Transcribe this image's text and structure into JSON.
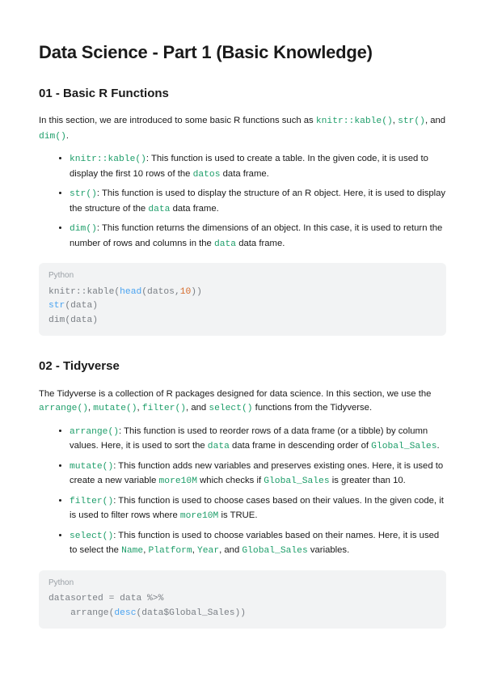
{
  "title": "Data Science - Part 1 (Basic Knowledge)",
  "sec1": {
    "heading": "01 - Basic R Functions",
    "intro_a": "In this section, we are introduced to some basic R functions such as ",
    "fn1": "knitr::kable()",
    "sep1": ", ",
    "fn2": "str()",
    "sep2": ", and ",
    "fn3": "dim()",
    "tail": ".",
    "b1": {
      "fn": "knitr::kable()",
      "a": ": This function is used to create a table. In the given code, it is used to display the first 10 rows of the ",
      "code1": "datos",
      "b": " data frame."
    },
    "b2": {
      "fn": "str()",
      "a": ": This function is used to display the structure of an R object. Here, it is used to display the structure of the ",
      "code1": "data",
      "b": " data frame."
    },
    "b3": {
      "fn": "dim()",
      "a": ": This function returns the dimensions of an object. In this case, it is used to return the number of rows and columns in the ",
      "code1": "data",
      "b": " data frame."
    },
    "code": {
      "lang": "Python",
      "l1a": "knitr::kable(",
      "l1b": "head",
      "l1c": "(datos,",
      "l1d": "10",
      "l1e": "))",
      "l2a": "str",
      "l2b": "(data)",
      "l3": "dim(data)"
    }
  },
  "sec2": {
    "heading": "02 - Tidyverse",
    "intro_a": "The Tidyverse is a collection of R packages designed for data science. In this section, we use the ",
    "fn1": "arrange()",
    "sep1": ", ",
    "fn2": "mutate()",
    "sep2": ", ",
    "fn3": "filter()",
    "sep3": ", and ",
    "fn4": "select()",
    "tail": " functions from the Tidyverse.",
    "b1": {
      "fn": "arrange()",
      "a": ": This function is used to reorder rows of a data frame (or a tibble) by column values. Here, it is used to sort the ",
      "c1": "data",
      "b": " data frame in descending order of ",
      "c2": "Global_Sales",
      "c": "."
    },
    "b2": {
      "fn": "mutate()",
      "a": ": This function adds new variables and preserves existing ones. Here, it is used to create a new variable ",
      "c1": "more10M",
      "b": " which checks if ",
      "c2": "Global_Sales",
      "c": " is greater than 10."
    },
    "b3": {
      "fn": "filter()",
      "a": ": This function is used to choose cases based on their values. In the given code, it is used to filter rows where ",
      "c1": "more10M",
      "b": " is TRUE."
    },
    "b4": {
      "fn": "select()",
      "a": ": This function is used to choose variables based on their names. Here, it is used to select the ",
      "c1": "Name",
      "s1": ", ",
      "c2": "Platform",
      "s2": ", ",
      "c3": "Year",
      "s3": ", and ",
      "c4": "Global_Sales",
      "c": " variables."
    },
    "code": {
      "lang": "Python",
      "l1": "datasorted = data %>%",
      "l2a": "    arrange(",
      "l2b": "desc",
      "l2c": "(data$Global_Sales))"
    }
  }
}
